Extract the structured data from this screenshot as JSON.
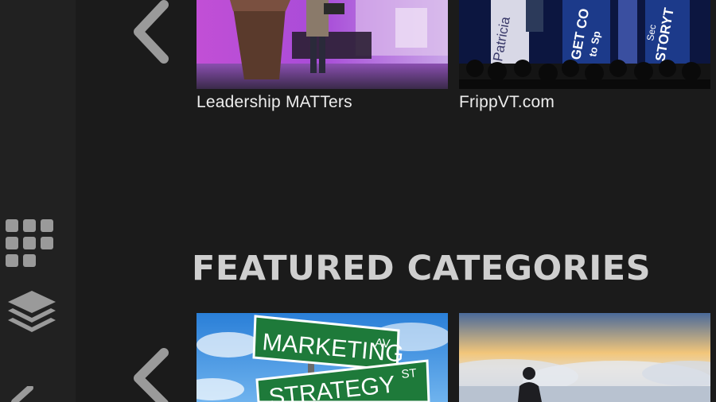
{
  "sidebar": {
    "icons": [
      "grid-icon",
      "layers-icon",
      "chevron-left-icon"
    ]
  },
  "carousel_top": {
    "nav_icon": "chevron-left-icon",
    "items": [
      {
        "title": "Leadership MATTers"
      },
      {
        "title": "FrippVT.com",
        "banner_texts": [
          "Patricia",
          "GET CO",
          "to Sp",
          "STORYT",
          "Sec"
        ]
      }
    ]
  },
  "featured": {
    "heading": "FEATURED CATEGORIES",
    "nav_icon": "chevron-left-icon",
    "items": [
      {
        "sign_texts": [
          "MARKETING",
          "AV",
          "STRATEGY",
          "ST"
        ]
      },
      {
        "scene": "clouds"
      }
    ]
  },
  "colors": {
    "background": "#1b1b1b",
    "sidebar": "#212121",
    "icon": "#9a9a9a",
    "caption": "#ededed",
    "heading": "#cfcfcf"
  }
}
